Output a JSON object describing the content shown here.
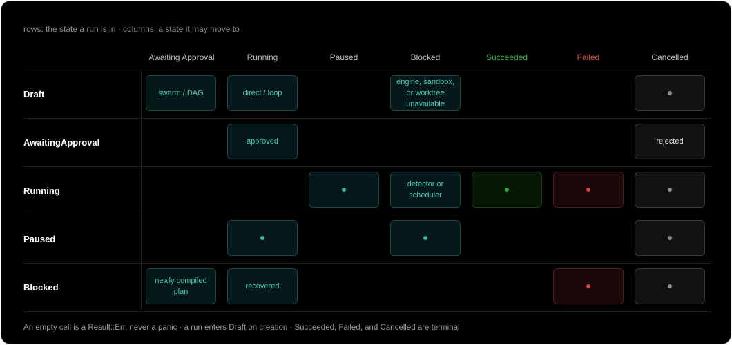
{
  "caption": "rows: the state a run is in · columns: a state it may move to",
  "footnote": "An empty cell is a Result::Err, never a panic · a run enters Draft on creation · Succeeded, Failed, and Cancelled are terminal",
  "columns": [
    "Awaiting Approval",
    "Running",
    "Paused",
    "Blocked",
    "Succeeded",
    "Failed",
    "Cancelled"
  ],
  "rows": [
    "Draft",
    "AwaitingApproval",
    "Running",
    "Paused",
    "Blocked"
  ],
  "colors": {
    "succeeded": "#34b34a",
    "failed": "#e0504a",
    "teal": "#4fc6b6",
    "background": "#000000"
  },
  "transitions": [
    {
      "row": 0,
      "col": 0,
      "style": "teal",
      "label": "swarm / DAG"
    },
    {
      "row": 0,
      "col": 1,
      "style": "teal",
      "label": "direct / loop"
    },
    {
      "row": 0,
      "col": 3,
      "style": "teal",
      "label": "engine, sandbox, or worktree unavailable"
    },
    {
      "row": 0,
      "col": 6,
      "style": "gray",
      "label": ""
    },
    {
      "row": 1,
      "col": 1,
      "style": "teal",
      "label": "approved"
    },
    {
      "row": 1,
      "col": 6,
      "style": "gray",
      "label": "rejected"
    },
    {
      "row": 2,
      "col": 2,
      "style": "teal",
      "label": ""
    },
    {
      "row": 2,
      "col": 3,
      "style": "teal",
      "label": "detector or scheduler"
    },
    {
      "row": 2,
      "col": 4,
      "style": "green",
      "label": ""
    },
    {
      "row": 2,
      "col": 5,
      "style": "red",
      "label": ""
    },
    {
      "row": 2,
      "col": 6,
      "style": "gray",
      "label": ""
    },
    {
      "row": 3,
      "col": 1,
      "style": "teal",
      "label": ""
    },
    {
      "row": 3,
      "col": 3,
      "style": "teal",
      "label": ""
    },
    {
      "row": 3,
      "col": 6,
      "style": "gray",
      "label": ""
    },
    {
      "row": 4,
      "col": 0,
      "style": "teal",
      "label": "newly compiled plan"
    },
    {
      "row": 4,
      "col": 1,
      "style": "teal",
      "label": "recovered"
    },
    {
      "row": 4,
      "col": 5,
      "style": "red",
      "label": ""
    },
    {
      "row": 4,
      "col": 6,
      "style": "gray",
      "label": ""
    }
  ]
}
